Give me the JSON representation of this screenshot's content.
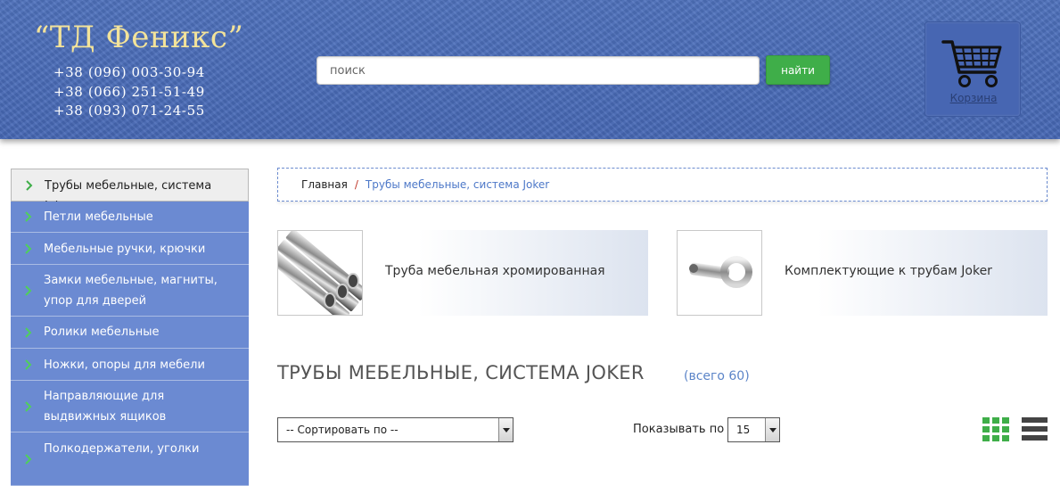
{
  "header": {
    "logo": "“ТД Феникс”",
    "phones": [
      "+38 (096) 003-30-94",
      "+38 (066) 251-51-49",
      "+38 (093) 071-24-55"
    ],
    "search_placeholder": "поиск",
    "search_button": "найти",
    "cart_label": "Корзина"
  },
  "sidebar": {
    "items": [
      {
        "label": "Трубы мебельные, система Joker",
        "active": true
      },
      {
        "label": "Петли мебельные"
      },
      {
        "label": "Мебельные ручки, крючки"
      },
      {
        "label": "Замки мебельные, магниты, упор для дверей"
      },
      {
        "label": "Ролики мебельные"
      },
      {
        "label": "Ножки, опоры для мебели"
      },
      {
        "label": "Направляющие для выдвижных ящиков"
      },
      {
        "label": "Полкодержатели, уголки"
      }
    ]
  },
  "breadcrumb": {
    "home": "Главная",
    "separator": "/",
    "current": "Трубы мебельные, система Joker"
  },
  "categories": [
    {
      "label": "Труба мебельная хромированная"
    },
    {
      "label": "Комплектующие к трубам Joker"
    }
  ],
  "heading": "ТРУБЫ МЕБЕЛЬНЫЕ, СИСТЕМА JOKER",
  "count": "(всего 60)",
  "controls": {
    "sort_value": "-- Сортировать по --",
    "show_label": "Показывать по",
    "per_page_value": "15"
  },
  "colors": {
    "header_bg": "#4a6cb8",
    "sidebar_bg": "#6b8ad2",
    "accent_green": "#3fae49",
    "link_blue": "#4d78c8"
  }
}
